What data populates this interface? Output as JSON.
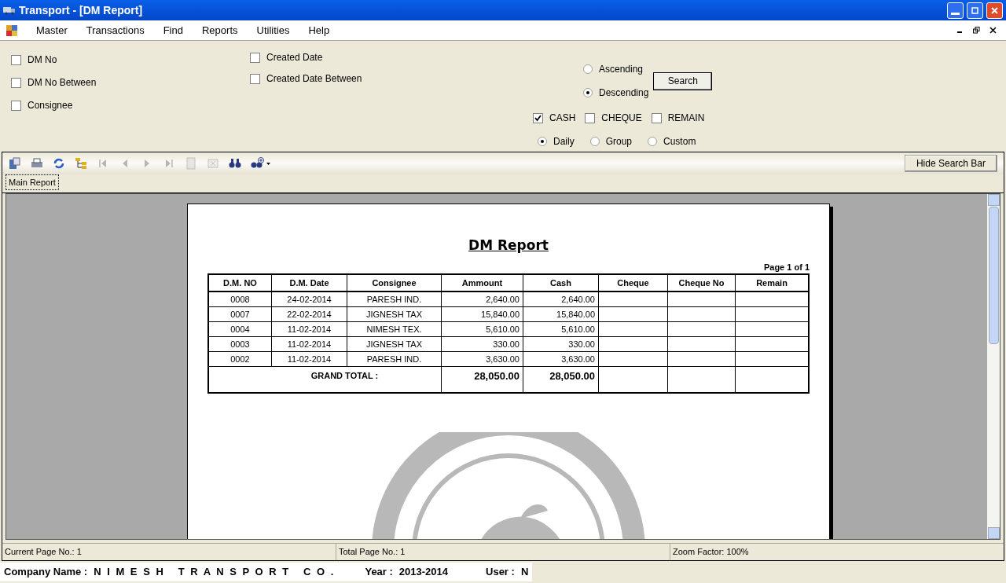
{
  "window": {
    "title": "Transport - [DM Report]"
  },
  "menu": [
    "Master",
    "Transactions",
    "Find",
    "Reports",
    "Utilities",
    "Help"
  ],
  "filters_left": [
    {
      "label": "DM No",
      "checked": false
    },
    {
      "label": "DM No Between",
      "checked": false
    },
    {
      "label": "Consignee",
      "checked": false
    }
  ],
  "filters_date": [
    {
      "label": "Created Date",
      "checked": false
    },
    {
      "label": "Created Date Between",
      "checked": false
    }
  ],
  "sort": [
    {
      "label": "Ascending",
      "selected": false
    },
    {
      "label": "Descending",
      "selected": true
    }
  ],
  "search_button": "Search",
  "payment": [
    {
      "label": "CASH",
      "checked": true
    },
    {
      "label": "CHEQUE",
      "checked": false
    },
    {
      "label": "REMAIN",
      "checked": false
    }
  ],
  "period": [
    {
      "label": "Daily",
      "selected": true
    },
    {
      "label": "Group",
      "selected": false
    },
    {
      "label": "Custom",
      "selected": false
    }
  ],
  "hide_search_bar": "Hide Search Bar",
  "report_tab": "Main Report",
  "report": {
    "title": "DM Report",
    "page": "Page 1 of 1",
    "columns": [
      "D.M. NO",
      "D.M. Date",
      "Consignee",
      "Ammount",
      "Cash",
      "Cheque",
      "Cheque No",
      "Remain"
    ],
    "rows": [
      [
        "0008",
        "24-02-2014",
        "PARESH IND.",
        "2,640.00",
        "2,640.00"
      ],
      [
        "0007",
        "22-02-2014",
        "JIGNESH TAX",
        "15,840.00",
        "15,840.00"
      ],
      [
        "0004",
        "11-02-2014",
        "NIMESH TEX.",
        "5,610.00",
        "5,610.00"
      ],
      [
        "0003",
        "11-02-2014",
        "JIGNESH TAX",
        "330.00",
        "330.00"
      ],
      [
        "0002",
        "11-02-2014",
        "PARESH IND.",
        "3,630.00",
        "3,630.00"
      ]
    ],
    "total_label": "GRAND TOTAL :",
    "total_amount": "28,050.00",
    "total_cash": "28,050.00",
    "logo": {
      "kind": "picture"
    }
  },
  "status": [
    "Current Page No.: 1",
    "Total Page No.: 1",
    "Zoom Factor: 100%"
  ],
  "company": {
    "label": "Company Name :",
    "name": "N I M E S H   T R A N S P O R T   C O .",
    "year_label": "Year :",
    "year": "2013-2014",
    "user_label": "User :",
    "user": "N"
  }
}
